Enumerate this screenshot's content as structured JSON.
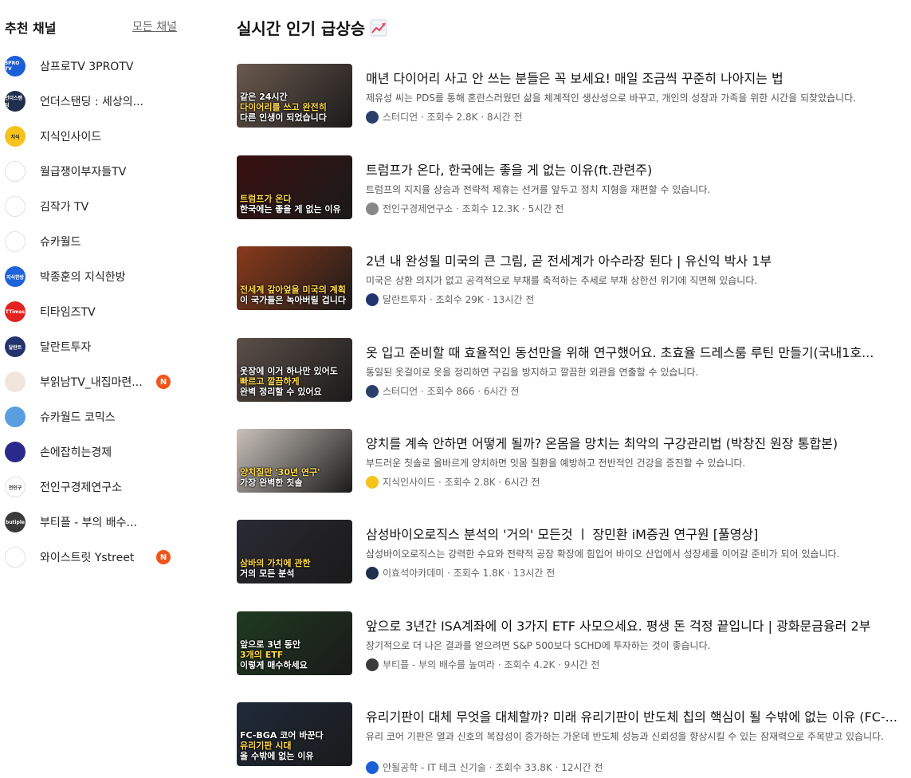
{
  "sidebar": {
    "title": "추천 채널",
    "all_link": "모든 채널",
    "channels": [
      {
        "name": "삼프로TV 3PROTV",
        "badge": "",
        "color": "#1a5fd6",
        "icon": "3protv-logo-icon",
        "abbr": "3PRO TV"
      },
      {
        "name": "언더스탠딩 : 세상의...",
        "badge": "",
        "color": "#1f2f4d",
        "icon": "understanding-logo-icon",
        "abbr": "언더스탠딩"
      },
      {
        "name": "지식인사이드",
        "badge": "",
        "color": "#f6c21c",
        "icon": "jisik-inside-logo-icon",
        "abbr": "지식"
      },
      {
        "name": "월급쟁이부자들TV",
        "badge": "",
        "color": "#ffffff",
        "icon": "wolgeup-logo-icon",
        "abbr": ""
      },
      {
        "name": "김작가 TV",
        "badge": "",
        "color": "#ffffff",
        "icon": "kimjakga-logo-icon",
        "abbr": ""
      },
      {
        "name": "슈카월드",
        "badge": "",
        "color": "#ffffff",
        "icon": "syuka-logo-icon",
        "abbr": ""
      },
      {
        "name": "박종훈의 지식한방",
        "badge": "",
        "color": "#1e63d8",
        "icon": "park-jonghoon-logo-icon",
        "abbr": "지식한방"
      },
      {
        "name": "티타임즈TV",
        "badge": "",
        "color": "#e32222",
        "icon": "ttimes-logo-icon",
        "abbr": "TTimes"
      },
      {
        "name": "달란트투자",
        "badge": "",
        "color": "#23336e",
        "icon": "dalant-logo-icon",
        "abbr": "달란트"
      },
      {
        "name": "부읽남TV_내집마련...",
        "badge": "N",
        "color": "#f1e6dd",
        "icon": "builknam-avatar-icon",
        "abbr": ""
      },
      {
        "name": "슈카월드 코믹스",
        "badge": "",
        "color": "#5a9ee0",
        "icon": "syuka-comics-logo-icon",
        "abbr": ""
      },
      {
        "name": "손에잡히는경제",
        "badge": "",
        "color": "#2a2a8a",
        "icon": "sonjab-logo-icon",
        "abbr": ""
      },
      {
        "name": "전인구경제연구소",
        "badge": "",
        "color": "#ffffff",
        "icon": "jeoningu-logo-icon",
        "abbr": "전인구"
      },
      {
        "name": "부티플 - 부의 배수...",
        "badge": "",
        "color": "#3a3a3a",
        "icon": "butiple-logo-icon",
        "abbr": "butiple"
      },
      {
        "name": "와이스트릿 Ystreet",
        "badge": "N",
        "color": "#ffffff",
        "icon": "ystreet-logo-icon",
        "abbr": ""
      }
    ]
  },
  "main": {
    "title": "실시간 인기 급상승",
    "title_icon": "chart-increasing-icon",
    "videos": [
      {
        "title": "매년 다이어리 사고 안 쓰는 분들은 꼭 보세요! 매일 조금씩 꾸준히 나아지는 법",
        "desc": "제유성 씨는 PDS를 통해 혼란스러웠던 삶을 체계적인 생산성으로 바꾸고, 개인의 성장과 가족을 위한 시간을 되찾았습니다.",
        "meta": "스터디언 · 조회수 2.8K · 8시간 전",
        "thumb_line1": "같은 24시간",
        "thumb_line2": "다이어리를 쓰고 완전히",
        "thumb_line3": "다른 인생이 되었습니다",
        "thumb_bg": "#6b5a4e",
        "meta_color": "#2b3f6b"
      },
      {
        "title": "트럼프가 온다, 한국에는 좋을 게 없는 이유(ft.관련주)",
        "desc": "트럼프의 지지율 상승과 전략적 제휴는 선거를 앞두고 정치 지형을 재편할 수 있습니다.",
        "meta": "전인구경제연구소 · 조회수 12.3K · 5시간 전",
        "thumb_line1": "",
        "thumb_line2": "트럼프가 온다",
        "thumb_line3": "한국에는 좋을 게 없는 이유",
        "thumb_bg": "#3a1010",
        "meta_color": "#888888"
      },
      {
        "title": "2년 내 완성될 미국의 큰 그림, 곧 전세계가 아수라장 된다 | 유신익 박사 1부",
        "desc": "미국은 상환 의지가 없고 공격적으로 부채를 축적하는 추세로 부채 상한선 위기에 직면해 있습니다.",
        "meta": "달란트투자 · 조회수 29K · 13시간 전",
        "thumb_line1": "",
        "thumb_line2": "전세계 갚아엎을 미국의 계획",
        "thumb_line3": "이 국가들은 녹아버릴 겁니다",
        "thumb_bg": "#8a3a1a",
        "meta_color": "#23336e"
      },
      {
        "title": "옷 입고 준비할 때 효율적인 동선만을 위해 연구했어요. 초효율 드레스룸 루틴 만들기(국내1호...",
        "desc": "통일된 옷걸이로 옷을 정리하면 구김을 방지하고 깔끔한 외관을 연출할 수 있습니다.",
        "meta": "스터디언 · 조회수 866 · 6시간 전",
        "thumb_line1": "옷장에 이거 하나만 있어도",
        "thumb_line2": "빠르고 깔끔하게",
        "thumb_line3": "완벽 정리할 수 있어요",
        "thumb_bg": "#5c4f48",
        "meta_color": "#2b3f6b"
      },
      {
        "title": "양치를 계속 안하면 어떻게 될까? 온몸을 망치는 최악의 구강관리법 (박창진 원장 통합본)",
        "desc": "부드러운 칫솔로 올바르게 양치하면 잇몸 질환을 예방하고 전반적인 건강을 증진할 수 있습니다.",
        "meta": "지식인사이드 · 조회수 2.8K · 6시간 전",
        "thumb_line1": "",
        "thumb_line2": "양치질만 '30년 연구'",
        "thumb_line3": "가장 완벽한 칫솔",
        "thumb_bg": "#c9c2bb",
        "meta_color": "#f6c21c"
      },
      {
        "title": "삼성바이오로직스 분석의 '거의' 모든것 ㅣ 장민환 iM증권 연구원 [풀영상]",
        "desc": "삼성바이오로직스는 강력한 수요와 전략적 공장 확장에 힘입어 바이오 산업에서 성장세를 이어갈 준비가 되어 있습니다.",
        "meta": "이효석아카데미 · 조회수 1.8K · 13시간 전",
        "thumb_line1": "",
        "thumb_line2": "삼바의 가치에 관한",
        "thumb_line3": "거의 모든 분석",
        "thumb_bg": "#2a2a33",
        "meta_color": "#1f2f4d"
      },
      {
        "title": "앞으로 3년간 ISA계좌에 이 3가지 ETF 사모으세요. 평생 돈 걱정 끝입니다 | 광화문금융러 2부",
        "desc": "장기적으로 더 나은 결과를 얻으려면 S&P 500보다 SCHD에 투자하는 것이 좋습니다.",
        "meta": "부티플 - 부의 배수를 높여라 · 조회수 4.2K · 9시간 전",
        "thumb_line1": "앞으로 3년 동안",
        "thumb_line2": "3개의 ETF",
        "thumb_line3": "이렇게 매수하세요",
        "thumb_bg": "#1f3a1f",
        "meta_color": "#3a3a3a"
      },
      {
        "title": "유리기판이 대체 무엇을 대체할까? 미래 유리기판이 반도체 칩의 핵심이 될 수밖에 없는 이유 (FC-...",
        "desc": "유리 코어 기판은 열과 신호의 복잡성이 증가하는 가운데 반도체 성능과 신뢰성을 향상시킬 수 있는 잠재력으로 주목받고 있습니다.",
        "meta": "안될공학 - IT 테크 신기술 · 조회수 33.8K · 12시간 전",
        "thumb_line1": "FC-BGA 코어 바꾼다",
        "thumb_line2": "유리기판 시대",
        "thumb_line3": "올 수밖에 없는 이유",
        "thumb_bg": "#1f2a3a",
        "meta_color": "#1a5fd6"
      }
    ]
  }
}
